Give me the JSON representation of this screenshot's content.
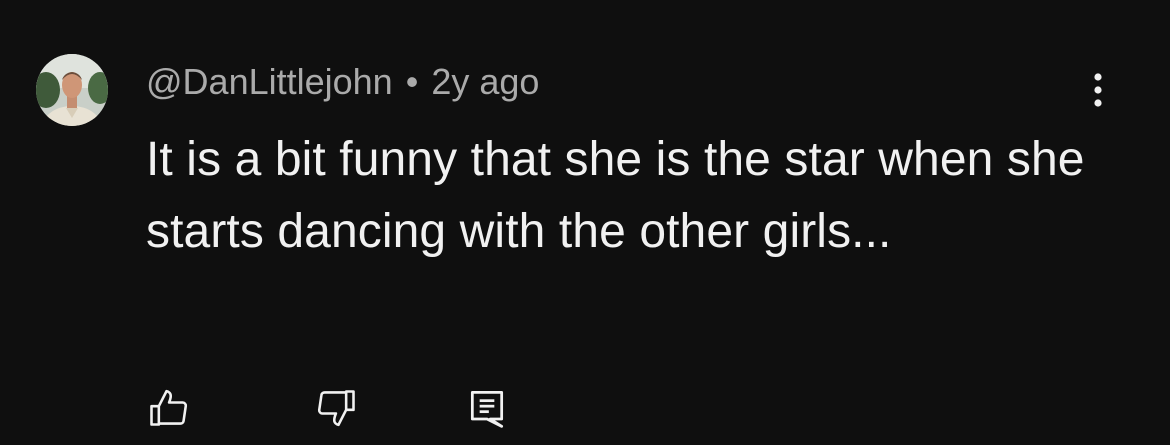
{
  "comment": {
    "author": "@DanLittlejohn",
    "separator": "•",
    "time": "2y ago",
    "text": "It is a bit funny that she is the star when she starts dancing with the other girls...",
    "avatar": "user-photo-avatar",
    "icons": {
      "menu": "more-vertical-icon",
      "like": "thumbs-up-icon",
      "dislike": "thumbs-down-icon",
      "reply": "reply-comment-icon"
    }
  },
  "colors": {
    "background": "#0f0f0f",
    "primary_text": "#f1f1f1",
    "secondary_text": "#aaaaaa"
  }
}
